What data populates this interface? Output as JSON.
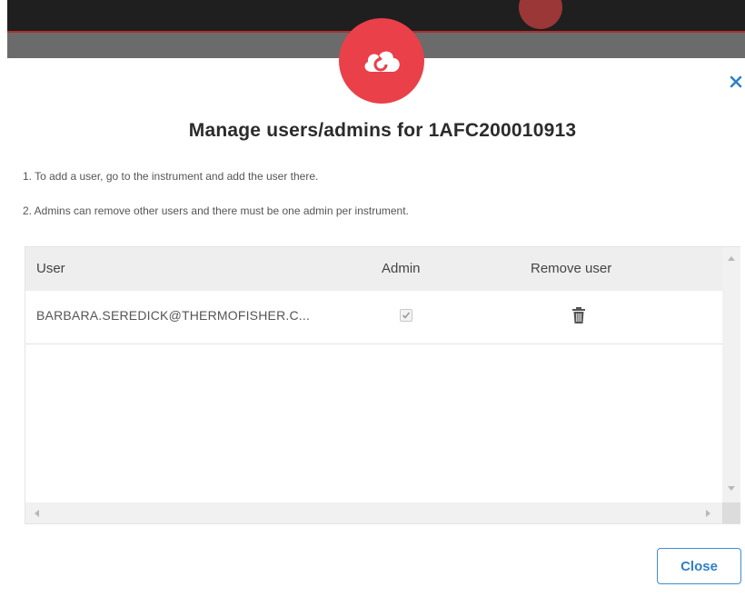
{
  "dialog": {
    "title": "Manage users/admins for 1AFC200010913",
    "instructions": [
      "1. To add a user, go to the instrument and add the user there.",
      "2. Admins can remove other users and there must be one admin per instrument."
    ],
    "close_label": "Close"
  },
  "table": {
    "headers": {
      "user": "User",
      "admin": "Admin",
      "remove": "Remove user"
    },
    "rows": [
      {
        "user": "BARBARA.SEREDICK@THERMOFISHER.C...",
        "admin": true,
        "remove_icon": "trash-icon"
      }
    ]
  },
  "icons": {
    "logo": "cloud-sync-icon",
    "close": "close-icon",
    "remove": "trash-icon"
  },
  "colors": {
    "brand_red": "#e9404a",
    "accent_blue": "#2f7fc8",
    "app_bar": "#1f1f1f"
  }
}
